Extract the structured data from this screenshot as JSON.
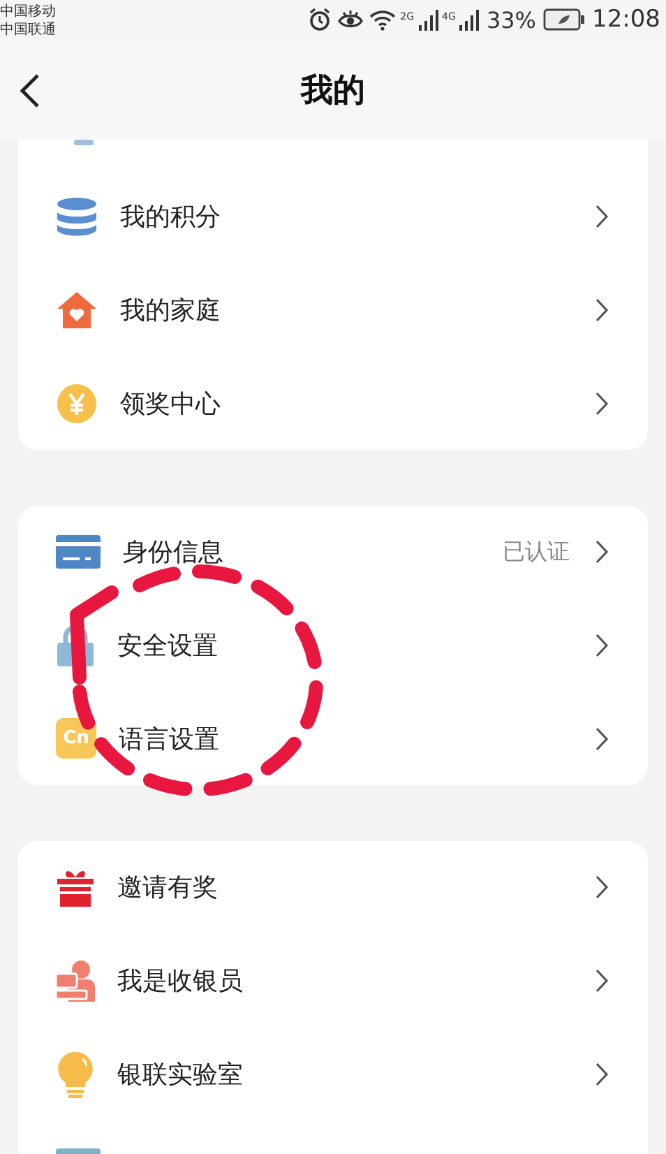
{
  "status_bar": {
    "carriers": [
      "中国移动",
      "中国联通"
    ],
    "signals": [
      {
        "label": "2G"
      },
      {
        "label": "4G"
      }
    ],
    "battery": "33%",
    "time": "12:08"
  },
  "header": {
    "title": "我的"
  },
  "groups": [
    {
      "items": [
        {
          "kind": "coins",
          "label": "我的积分"
        },
        {
          "kind": "house",
          "label": "我的家庭"
        },
        {
          "kind": "yen",
          "label": "领奖中心"
        }
      ]
    },
    {
      "items": [
        {
          "kind": "card",
          "label": "身份信息",
          "value": "已认证"
        },
        {
          "kind": "lock",
          "label": "安全设置"
        },
        {
          "kind": "badge",
          "badge": "Cn",
          "label": "语言设置"
        }
      ]
    },
    {
      "items": [
        {
          "kind": "gift",
          "label": "邀请有奖"
        },
        {
          "kind": "cashier",
          "label": "我是收银员"
        },
        {
          "kind": "bulb",
          "label": "银联实验室"
        }
      ]
    }
  ]
}
